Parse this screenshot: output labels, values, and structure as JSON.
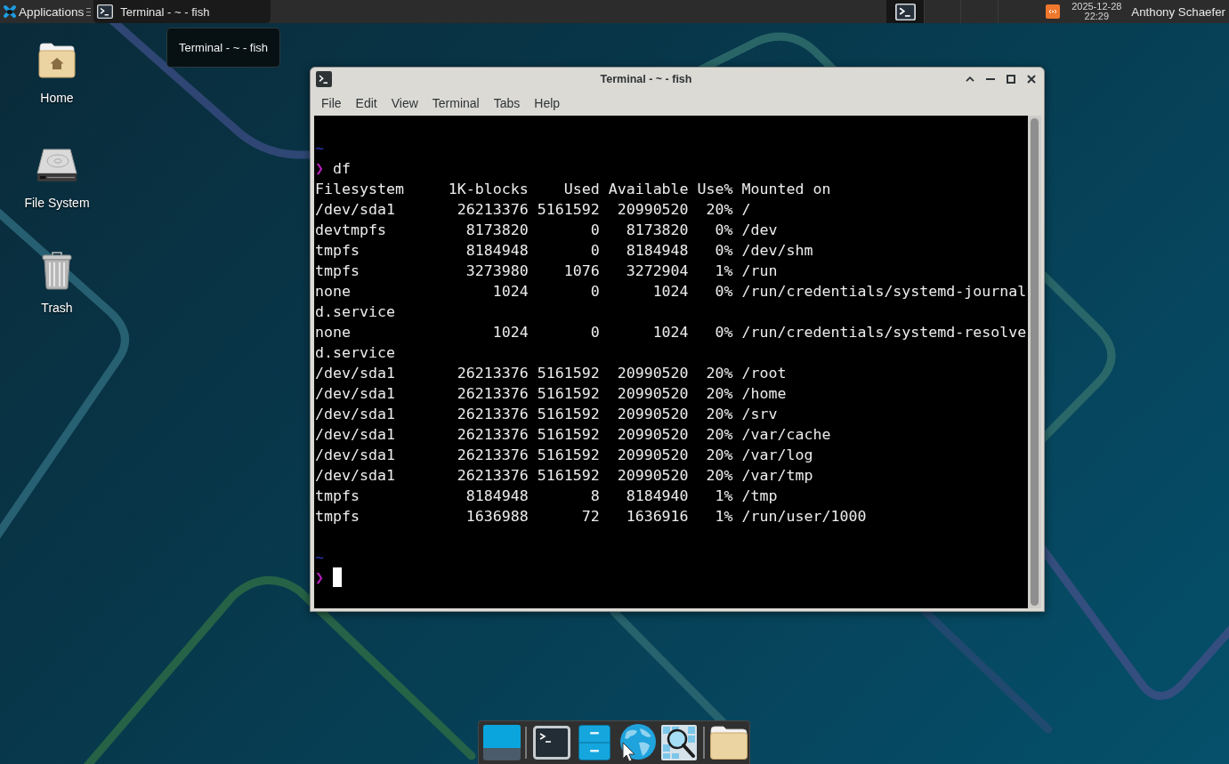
{
  "top_panel": {
    "app_menu": {
      "label": "Applications"
    },
    "tasks": [
      {
        "title": "Terminal - ~ - fish",
        "selected": true
      }
    ],
    "workspaces": [
      {
        "selected": true,
        "windows": [
          {
            "kind": "terminal"
          }
        ]
      },
      {
        "selected": false
      },
      {
        "selected": false
      },
      {
        "selected": false
      }
    ],
    "clock": {
      "date": "2025-12-28",
      "time": "22:29"
    },
    "user": "Anthony Schaefer"
  },
  "tooltip": "Terminal - ~ - fish",
  "desktop_icons": [
    {
      "kind": "home",
      "label": "Home"
    },
    {
      "kind": "drive",
      "label": "File System"
    },
    {
      "kind": "trash",
      "label": "Trash"
    }
  ],
  "terminal_window": {
    "title": "Terminal - ~ - fish",
    "menu": [
      "File",
      "Edit",
      "View",
      "Terminal",
      "Tabs",
      "Help"
    ],
    "lines": [
      {
        "kind": "prompt",
        "cwd": "~",
        "symbol": "❯",
        "command": "df",
        "cursor": false
      },
      {
        "kind": "output",
        "text": "Filesystem     1K-blocks    Used Available Use% Mounted on"
      },
      {
        "kind": "output",
        "text": "/dev/sda1       26213376 5161592  20990520  20% /"
      },
      {
        "kind": "output",
        "text": "devtmpfs         8173820       0   8173820   0% /dev"
      },
      {
        "kind": "output",
        "text": "tmpfs            8184948       0   8184948   0% /dev/shm"
      },
      {
        "kind": "output",
        "text": "tmpfs            3273980    1076   3272904   1% /run"
      },
      {
        "kind": "output",
        "text": "none                1024       0      1024   0% /run/credentials/systemd-journal"
      },
      {
        "kind": "output",
        "text": "d.service"
      },
      {
        "kind": "output",
        "text": "none                1024       0      1024   0% /run/credentials/systemd-resolve"
      },
      {
        "kind": "output",
        "text": "d.service"
      },
      {
        "kind": "output",
        "text": "/dev/sda1       26213376 5161592  20990520  20% /root"
      },
      {
        "kind": "output",
        "text": "/dev/sda1       26213376 5161592  20990520  20% /home"
      },
      {
        "kind": "output",
        "text": "/dev/sda1       26213376 5161592  20990520  20% /srv"
      },
      {
        "kind": "output",
        "text": "/dev/sda1       26213376 5161592  20990520  20% /var/cache"
      },
      {
        "kind": "output",
        "text": "/dev/sda1       26213376 5161592  20990520  20% /var/log"
      },
      {
        "kind": "output",
        "text": "/dev/sda1       26213376 5161592  20990520  20% /var/tmp"
      },
      {
        "kind": "output",
        "text": "tmpfs            8184948       8   8184940   1% /tmp"
      },
      {
        "kind": "output",
        "text": "tmpfs            1636988      72   1636916   1% /run/user/1000"
      },
      {
        "kind": "prompt",
        "cwd": "~",
        "symbol": "❯",
        "cursor": true
      }
    ]
  },
  "dock": {
    "items": [
      {
        "kind": "show-desktop"
      },
      {
        "kind": "separator"
      },
      {
        "kind": "terminal"
      },
      {
        "kind": "files"
      },
      {
        "kind": "browser"
      },
      {
        "kind": "app-finder"
      },
      {
        "kind": "separator"
      },
      {
        "kind": "folder"
      }
    ]
  }
}
